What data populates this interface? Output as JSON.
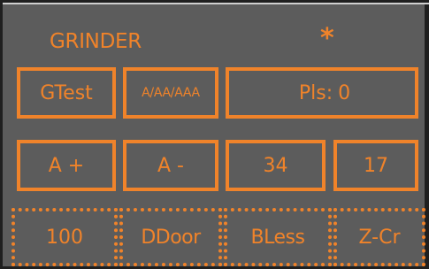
{
  "colors": {
    "background": "#5c5c5c",
    "accent": "#f0832a",
    "frame": "#1f1f1f"
  },
  "header": {
    "title": "GRINDER",
    "status_glyph": "*"
  },
  "row1": {
    "gtest_label": "GTest",
    "aa_label": "A/AA/AAA",
    "pls_label": "Pls:",
    "pls_value": "0"
  },
  "row2": {
    "a_plus_label": "A +",
    "a_minus_label": "A -",
    "value_a": "34",
    "value_b": "17"
  },
  "row3": {
    "hundred_label": "100",
    "ddoor_label": "DDoor",
    "bless_label": "BLess",
    "zcr_label": "Z-Cr"
  }
}
